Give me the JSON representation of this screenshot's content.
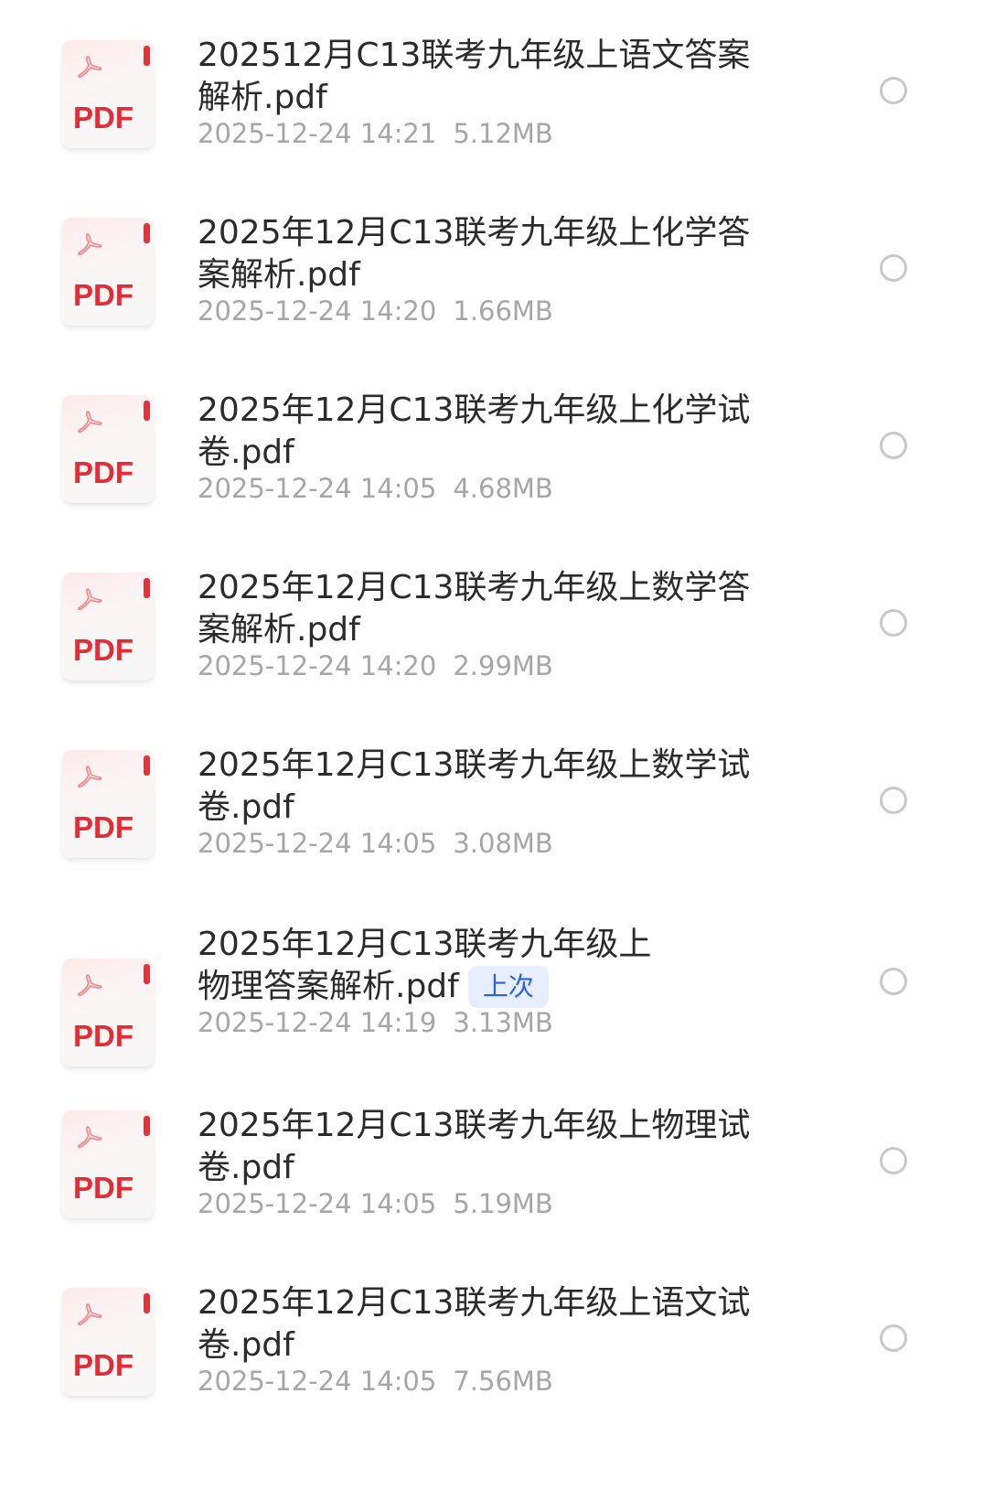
{
  "files": [
    {
      "name_line1": "202512月C13联考九年级上语文答案",
      "name_line2": "解析.pdf",
      "tag": "",
      "date": "2025-12-24 14:21",
      "size": "5.12MB",
      "icon_label": "PDF"
    },
    {
      "name_line1": "2025年12月C13联考九年级上化学答",
      "name_line2": "案解析.pdf",
      "tag": "",
      "date": "2025-12-24 14:20",
      "size": "1.66MB",
      "icon_label": "PDF"
    },
    {
      "name_line1": "2025年12月C13联考九年级上化学试",
      "name_line2": "卷.pdf",
      "tag": "",
      "date": "2025-12-24 14:05",
      "size": "4.68MB",
      "icon_label": "PDF"
    },
    {
      "name_line1": "2025年12月C13联考九年级上数学答",
      "name_line2": "案解析.pdf",
      "tag": "",
      "date": "2025-12-24 14:20",
      "size": "2.99MB",
      "icon_label": "PDF"
    },
    {
      "name_line1": "2025年12月C13联考九年级上数学试",
      "name_line2": "卷.pdf",
      "tag": "",
      "date": "2025-12-24 14:05",
      "size": "3.08MB",
      "icon_label": "PDF"
    },
    {
      "name_line1": "2025年12月C13联考九年级上",
      "name_line2": "物理答案解析.pdf",
      "tag": "上次",
      "date": "2025-12-24 14:19",
      "size": "3.13MB",
      "icon_label": "PDF"
    },
    {
      "name_line1": "2025年12月C13联考九年级上物理试",
      "name_line2": "卷.pdf",
      "tag": "",
      "date": "2025-12-24 14:05",
      "size": "5.19MB",
      "icon_label": "PDF"
    },
    {
      "name_line1": "2025年12月C13联考九年级上语文试",
      "name_line2": "卷.pdf",
      "tag": "",
      "date": "2025-12-24 14:05",
      "size": "7.56MB",
      "icon_label": "PDF"
    }
  ],
  "colors": {
    "pdf_red": "#e02d36",
    "badge_bg": "#e6eeff",
    "badge_text": "#2a62e6",
    "meta_gray": "#a6a6a6",
    "title_text": "#2b2b2b"
  },
  "icons": {
    "file_icon": "pdf-file-icon",
    "acrobat_glyph": "acrobat-icon",
    "select": "radio-unchecked-icon"
  }
}
